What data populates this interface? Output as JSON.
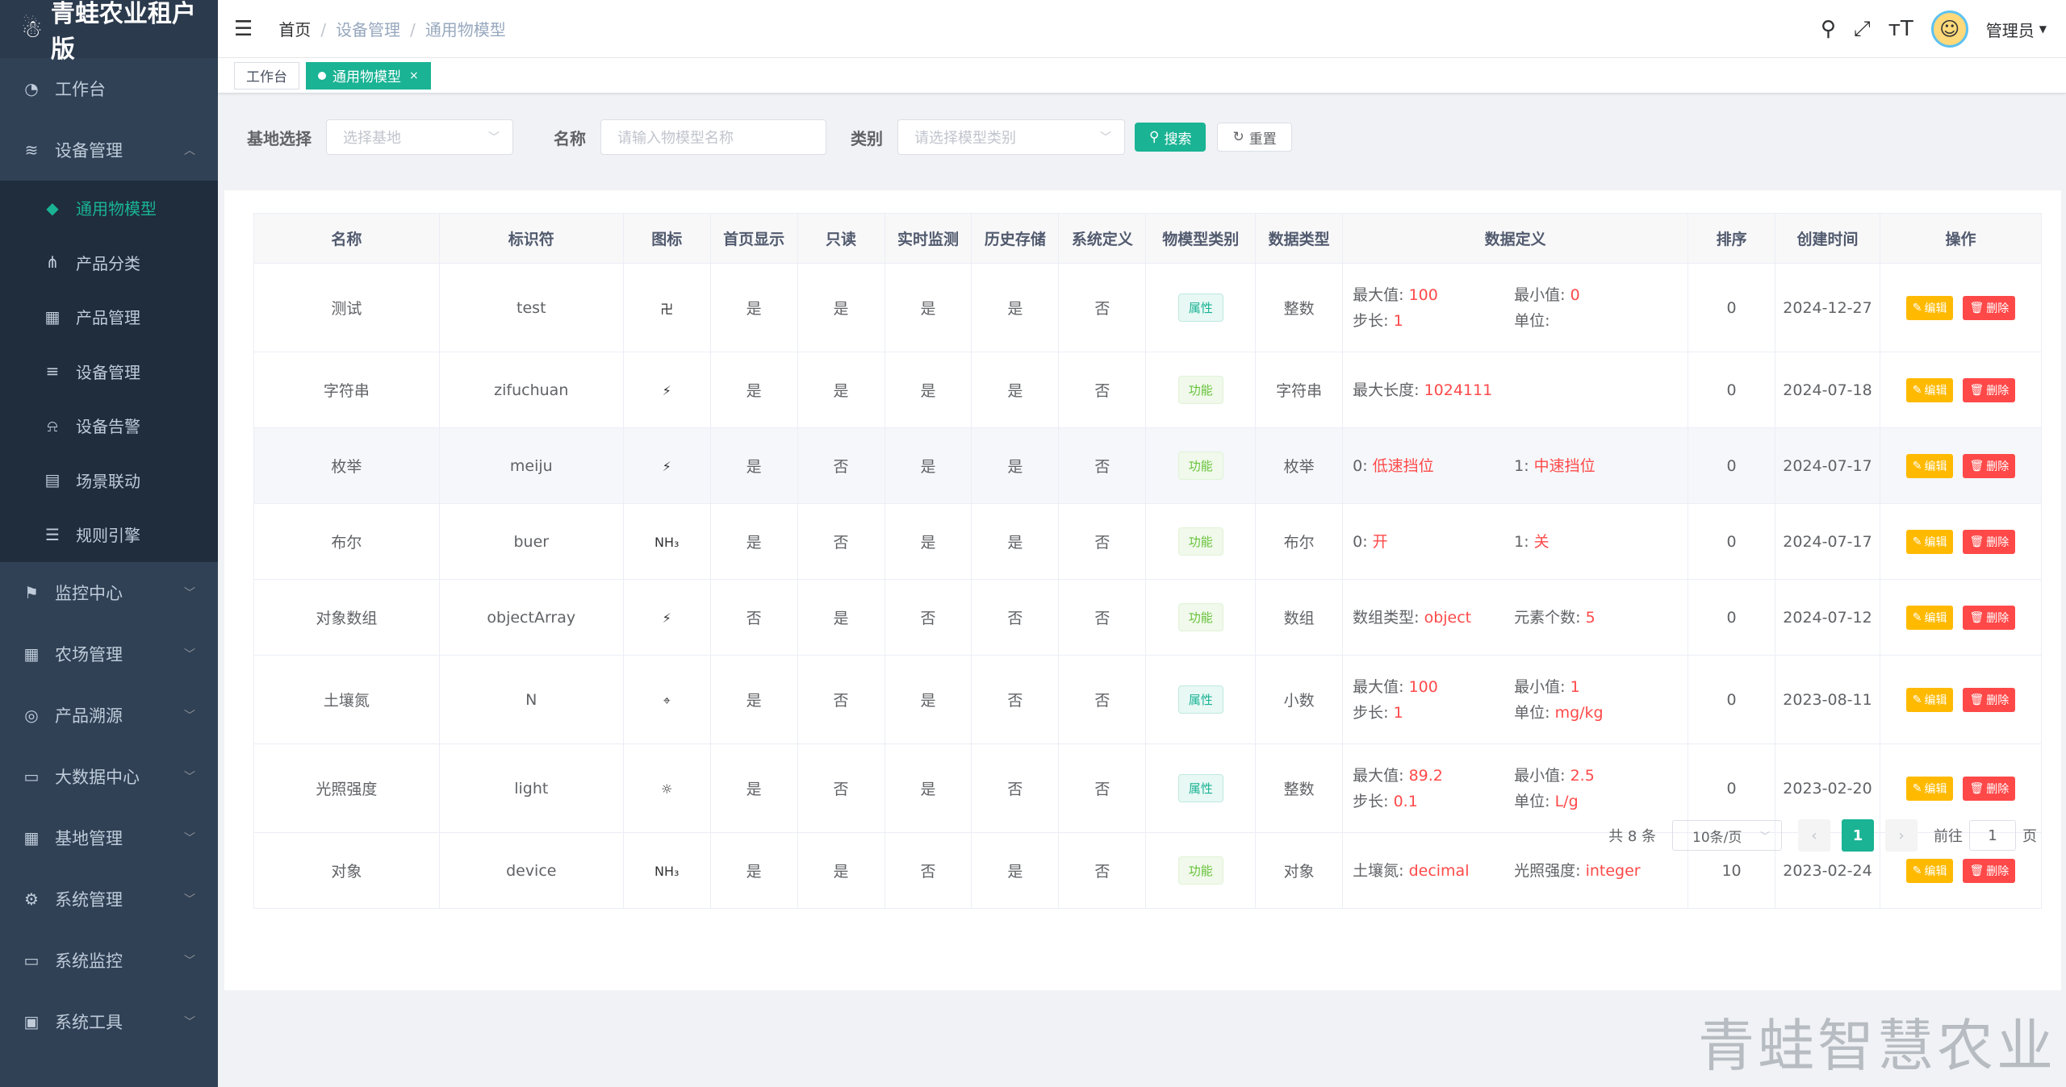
{
  "app_title": "青蛙农业租户版",
  "sidebar": {
    "items": [
      {
        "label": "工作台",
        "icon": "dashboard-icon"
      },
      {
        "label": "设备管理",
        "icon": "layers-icon",
        "expanded": true
      },
      {
        "label": "监控中心",
        "icon": "monitor-icon"
      },
      {
        "label": "农场管理",
        "icon": "grid-icon"
      },
      {
        "label": "产品溯源",
        "icon": "trace-icon"
      },
      {
        "label": "大数据中心",
        "icon": "screen-icon"
      },
      {
        "label": "基地管理",
        "icon": "grid-icon"
      },
      {
        "label": "系统管理",
        "icon": "gear-icon"
      },
      {
        "label": "系统监控",
        "icon": "screen-icon"
      },
      {
        "label": "系统工具",
        "icon": "toolbox-icon"
      }
    ],
    "sub_items": [
      {
        "label": "通用物模型",
        "icon": "cube-icon",
        "active": true
      },
      {
        "label": "产品分类",
        "icon": "tree-icon"
      },
      {
        "label": "产品管理",
        "icon": "grid-icon"
      },
      {
        "label": "设备管理",
        "icon": "list-icon"
      },
      {
        "label": "设备告警",
        "icon": "alarm-icon"
      },
      {
        "label": "场景联动",
        "icon": "scene-icon"
      },
      {
        "label": "规则引擎",
        "icon": "rules-icon"
      }
    ]
  },
  "navbar": {
    "breadcrumb": [
      "首页",
      "设备管理",
      "通用物模型"
    ],
    "user": "管理员"
  },
  "tags": {
    "tab1": "工作台",
    "tab2": "通用物模型"
  },
  "search": {
    "base_label": "基地选择",
    "base_placeholder": "选择基地",
    "name_label": "名称",
    "name_placeholder": "请输入物模型名称",
    "type_label": "类别",
    "type_placeholder": "请选择模型类别",
    "search_btn": "搜索",
    "reset_btn": "重置"
  },
  "table": {
    "headers": [
      "名称",
      "标识符",
      "图标",
      "首页显示",
      "只读",
      "实时监测",
      "历史存储",
      "系统定义",
      "物模型类别",
      "数据类型",
      "数据定义",
      "排序",
      "创建时间",
      "操作"
    ],
    "edit_label": "编辑",
    "delete_label": "删除",
    "rows": [
      {
        "name": "测试",
        "id": "test",
        "icon": "卍",
        "home": "是",
        "ro": "是",
        "rt": "是",
        "hist": "是",
        "sys": "否",
        "cat": "属性",
        "cat_type": "attr",
        "dtype": "整数",
        "def": [
          [
            {
              "k": "最大值:",
              "v": "100"
            },
            {
              "k": "最小值:",
              "v": "0"
            }
          ],
          [
            {
              "k": "步长:",
              "v": "1"
            },
            {
              "k": "单位:",
              "v": ""
            }
          ]
        ],
        "sort": "0",
        "time": "2024-12-27"
      },
      {
        "name": "字符串",
        "id": "zifuchuan",
        "icon": "⚡",
        "home": "是",
        "ro": "是",
        "rt": "是",
        "hist": "是",
        "sys": "否",
        "cat": "功能",
        "cat_type": "func",
        "dtype": "字符串",
        "def": [
          [
            {
              "k": "最大长度:",
              "v": "1024111"
            }
          ]
        ],
        "sort": "0",
        "time": "2024-07-18"
      },
      {
        "name": "枚举",
        "id": "meiju",
        "icon": "⚡",
        "home": "是",
        "ro": "否",
        "rt": "是",
        "hist": "是",
        "sys": "否",
        "cat": "功能",
        "cat_type": "func",
        "dtype": "枚举",
        "def": [
          [
            {
              "k": "0:",
              "v": "低速挡位"
            },
            {
              "k": "1:",
              "v": "中速挡位"
            }
          ]
        ],
        "sort": "0",
        "time": "2024-07-17"
      },
      {
        "name": "布尔",
        "id": "buer",
        "icon": "NH₃",
        "home": "是",
        "ro": "否",
        "rt": "是",
        "hist": "是",
        "sys": "否",
        "cat": "功能",
        "cat_type": "func",
        "dtype": "布尔",
        "def": [
          [
            {
              "k": "0:",
              "v": "开"
            },
            {
              "k": "1:",
              "v": "关"
            }
          ]
        ],
        "sort": "0",
        "time": "2024-07-17"
      },
      {
        "name": "对象数组",
        "id": "objectArray",
        "icon": "⚡",
        "home": "否",
        "ro": "是",
        "rt": "否",
        "hist": "否",
        "sys": "否",
        "cat": "功能",
        "cat_type": "func",
        "dtype": "数组",
        "def": [
          [
            {
              "k": "数组类型:",
              "v": "object"
            },
            {
              "k": "元素个数:",
              "v": "5"
            }
          ]
        ],
        "sort": "0",
        "time": "2024-07-12"
      },
      {
        "name": "土壤氮",
        "id": "N",
        "icon": "⌖",
        "home": "是",
        "ro": "否",
        "rt": "是",
        "hist": "否",
        "sys": "否",
        "cat": "属性",
        "cat_type": "attr",
        "dtype": "小数",
        "def": [
          [
            {
              "k": "最大值:",
              "v": "100"
            },
            {
              "k": "最小值:",
              "v": "1"
            }
          ],
          [
            {
              "k": "步长:",
              "v": "1"
            },
            {
              "k": "单位:",
              "v": "mg/kg"
            }
          ]
        ],
        "sort": "0",
        "time": "2023-08-11"
      },
      {
        "name": "光照强度",
        "id": "light",
        "icon": "☼",
        "home": "是",
        "ro": "否",
        "rt": "是",
        "hist": "否",
        "sys": "否",
        "cat": "属性",
        "cat_type": "attr",
        "dtype": "整数",
        "def": [
          [
            {
              "k": "最大值:",
              "v": "89.2"
            },
            {
              "k": "最小值:",
              "v": "2.5"
            }
          ],
          [
            {
              "k": "步长:",
              "v": "0.1"
            },
            {
              "k": "单位:",
              "v": "L/g"
            }
          ]
        ],
        "sort": "0",
        "time": "2023-02-20"
      },
      {
        "name": "对象",
        "id": "device",
        "icon": "NH₃",
        "home": "是",
        "ro": "是",
        "rt": "否",
        "hist": "是",
        "sys": "否",
        "cat": "功能",
        "cat_type": "func",
        "dtype": "对象",
        "def": [
          [
            {
              "k": "土壤氮:",
              "v": "decimal"
            },
            {
              "k": "光照强度:",
              "v": "integer"
            }
          ]
        ],
        "sort": "10",
        "time": "2023-02-24"
      }
    ]
  },
  "pager": {
    "total": "共 8 条",
    "size": "10条/页",
    "page": "1",
    "goto": "前往",
    "goto_val": "1",
    "page_unit": "页"
  },
  "watermark": "青蛙智慧农业"
}
